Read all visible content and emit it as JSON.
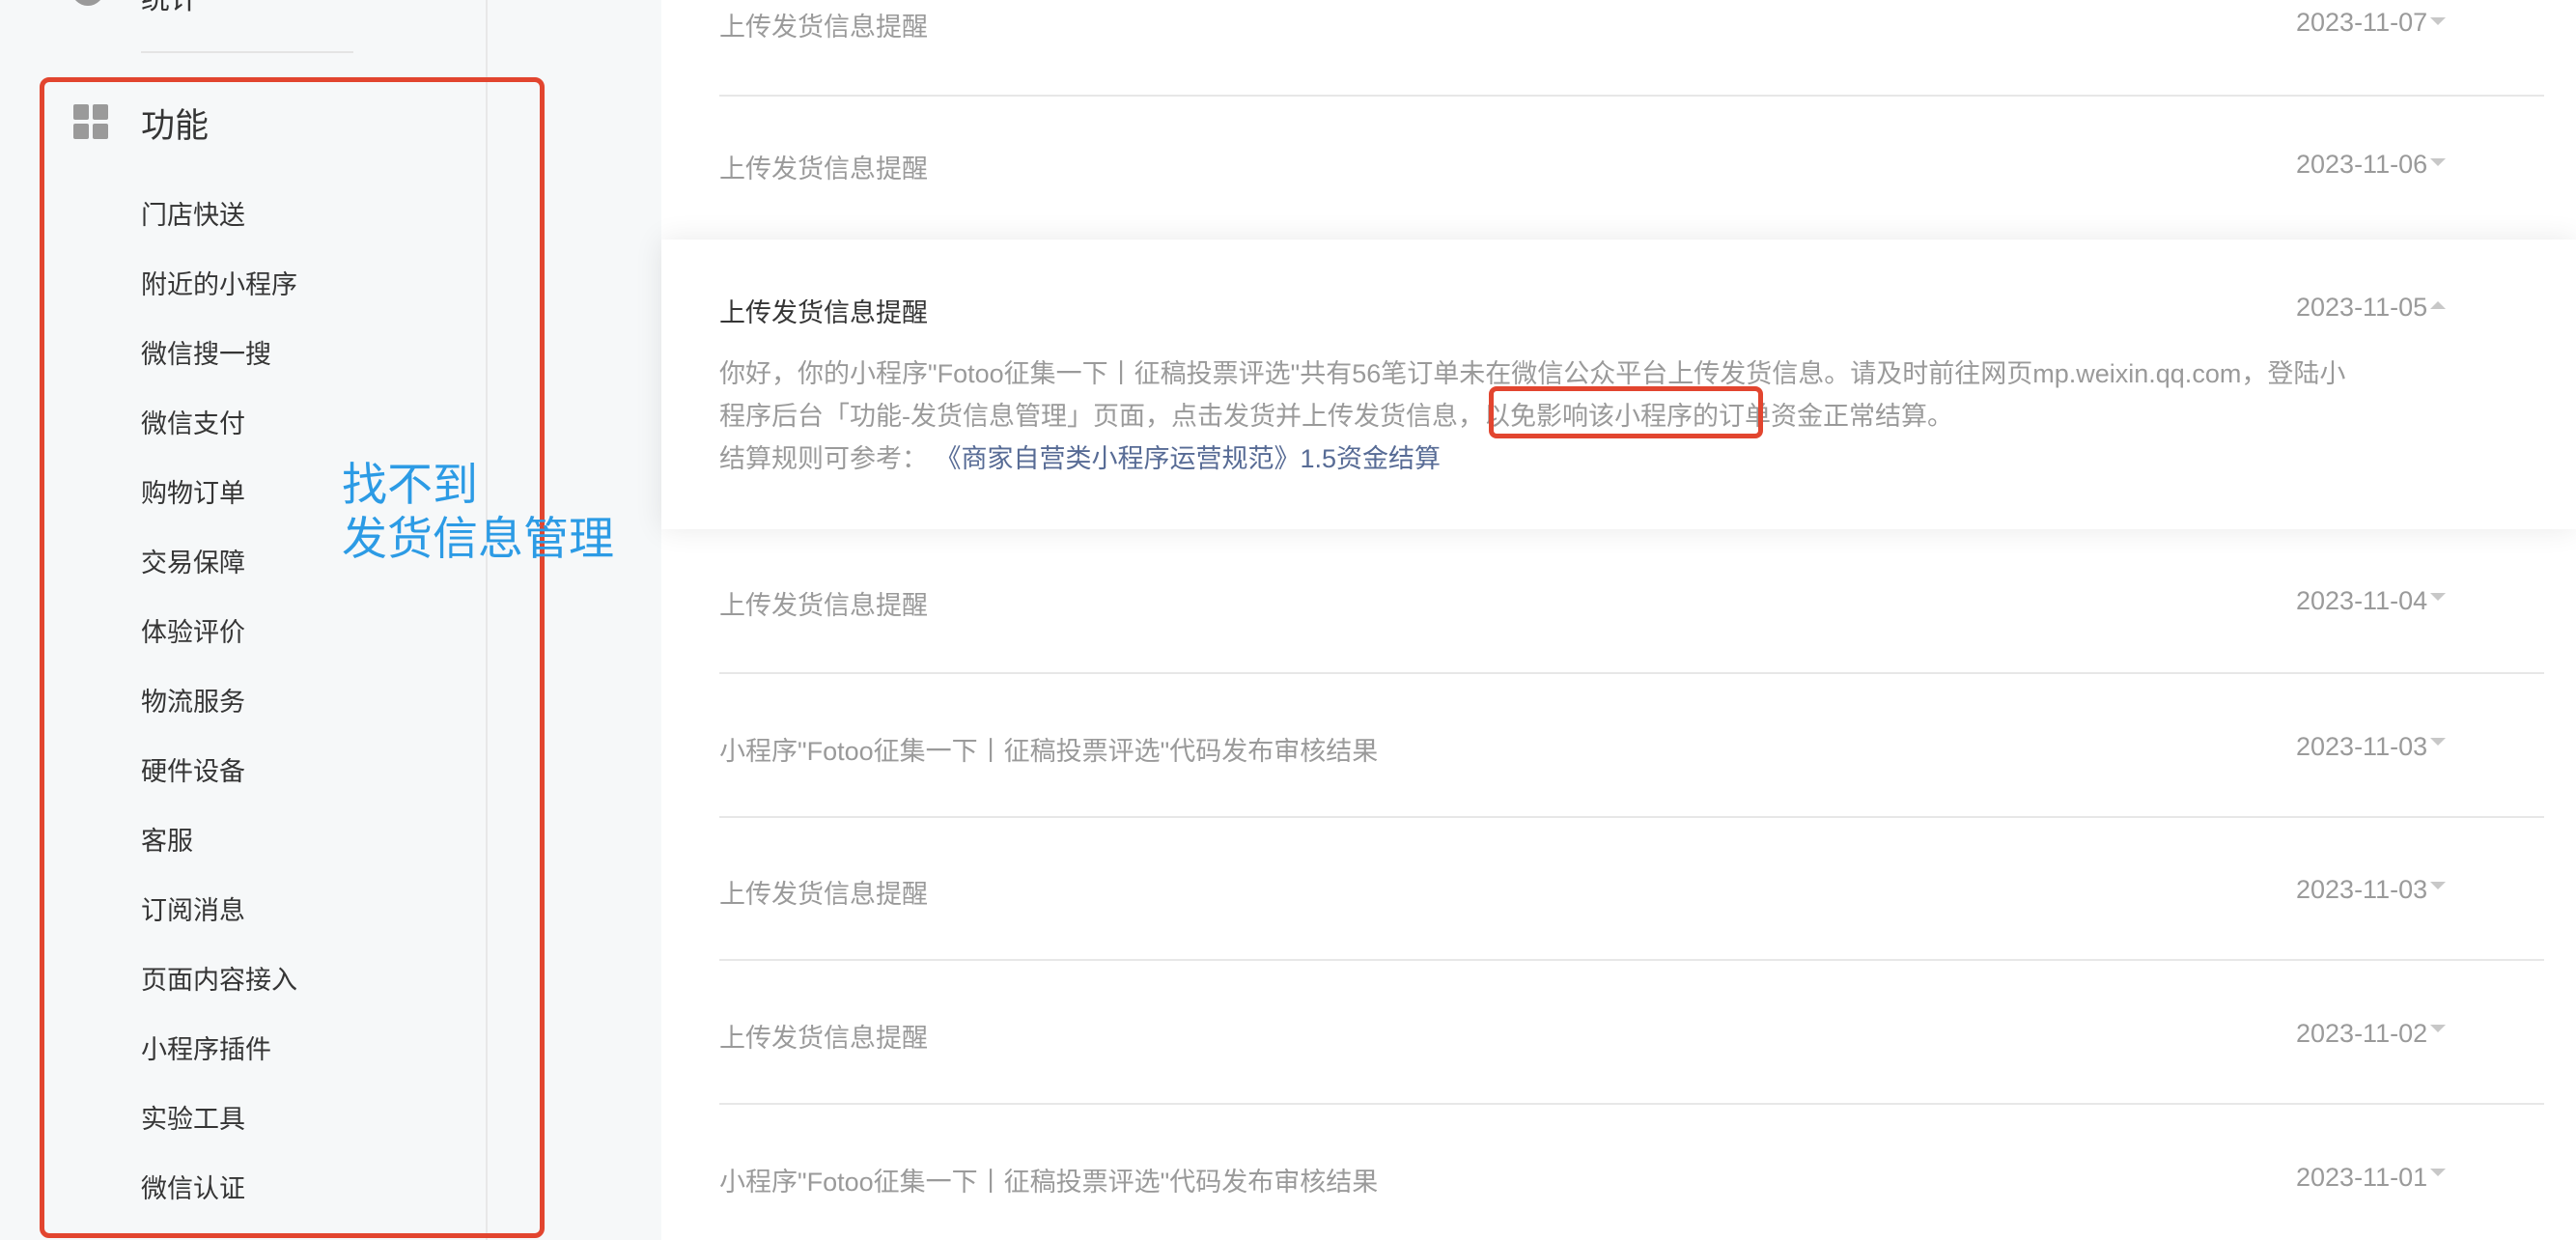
{
  "sidebar": {
    "top_item": {
      "label": "统计",
      "icon": "stats-icon"
    },
    "section": {
      "title": "功能",
      "icon": "grid-icon"
    },
    "items": [
      {
        "label": "门店快送"
      },
      {
        "label": "附近的小程序"
      },
      {
        "label": "微信搜一搜"
      },
      {
        "label": "微信支付"
      },
      {
        "label": "购物订单"
      },
      {
        "label": "交易保障"
      },
      {
        "label": "体验评价"
      },
      {
        "label": "物流服务"
      },
      {
        "label": "硬件设备"
      },
      {
        "label": "客服"
      },
      {
        "label": "订阅消息"
      },
      {
        "label": "页面内容接入"
      },
      {
        "label": "小程序插件"
      },
      {
        "label": "实验工具"
      },
      {
        "label": "微信认证"
      }
    ]
  },
  "annotation": {
    "line1": "找不到",
    "line2": "发货信息管理",
    "highlight_color": "#e2452f",
    "text_color": "#2c9be5"
  },
  "messages": [
    {
      "title": "上传发货信息提醒",
      "date": "2023-11-07"
    },
    {
      "title": "上传发货信息提醒",
      "date": "2023-11-06"
    },
    {
      "title": "上传发货信息提醒",
      "date": "2023-11-05",
      "expanded": true,
      "body_line1": "你好，你的小程序\"Fotoo征集一下丨征稿投票评选\"共有56笔订单未在微信公众平台上传发货信息。请及时前往网页mp.weixin.qq.com，登陆小",
      "body_line2": "程序后台「功能-发货信息管理」页面，点击发货并上传发货信息，以免影响该小程序的订单资金正常结算。",
      "rule_prefix": "结算规则可参考：",
      "rule_link": "《商家自营类小程序运营规范》1.5资金结算"
    },
    {
      "title": "上传发货信息提醒",
      "date": "2023-11-04"
    },
    {
      "title": "小程序\"Fotoo征集一下丨征稿投票评选\"代码发布审核结果",
      "date": "2023-11-03"
    },
    {
      "title": "上传发货信息提醒",
      "date": "2023-11-03"
    },
    {
      "title": "上传发货信息提醒",
      "date": "2023-11-02"
    },
    {
      "title": "小程序\"Fotoo征集一下丨征稿投票评选\"代码发布审核结果",
      "date": "2023-11-01"
    }
  ]
}
